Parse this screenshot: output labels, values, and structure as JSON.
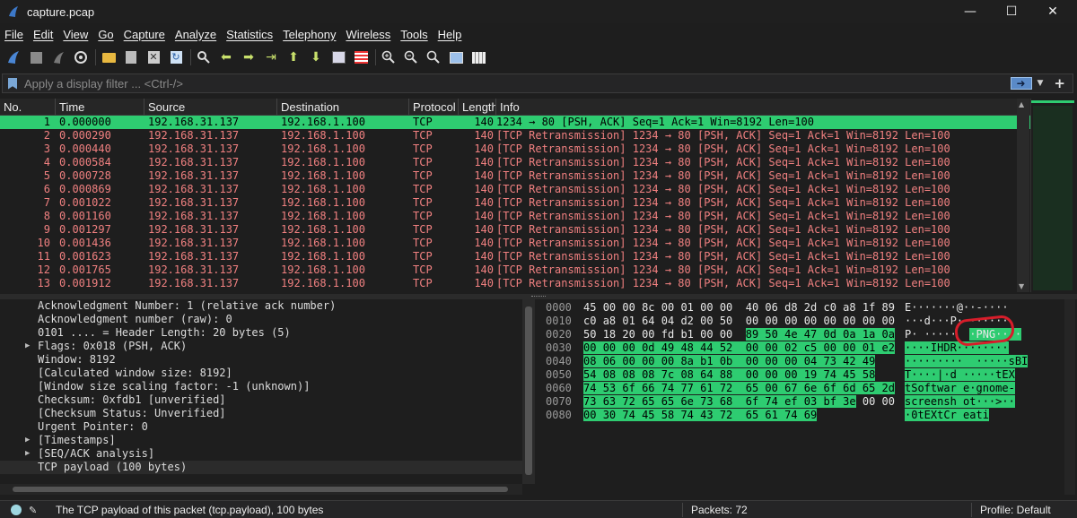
{
  "window": {
    "title": "capture.pcap"
  },
  "menu": [
    "File",
    "Edit",
    "View",
    "Go",
    "Capture",
    "Analyze",
    "Statistics",
    "Telephony",
    "Wireless",
    "Tools",
    "Help"
  ],
  "toolbar": {
    "icons": [
      "shark-fin-start-icon",
      "stop-icon",
      "restart-icon",
      "options-gear-icon",
      "open-folder-icon",
      "save-file-icon",
      "close-file-icon",
      "reload-icon",
      "find-icon",
      "go-back-icon",
      "go-forward-icon",
      "go-to-packet-icon",
      "go-first-icon",
      "go-last-icon",
      "autoscroll-icon",
      "colorize-icon",
      "zoom-in-icon",
      "zoom-out-icon",
      "zoom-normal-icon",
      "resize-columns-icon",
      "expand-icon"
    ]
  },
  "filter": {
    "placeholder": "Apply a display filter ... <Ctrl-/>"
  },
  "packet_list": {
    "columns": [
      "No.",
      "Time",
      "Source",
      "Destination",
      "Protocol",
      "Length",
      "Info"
    ],
    "rows": [
      {
        "no": "1",
        "time": "0.000000",
        "src": "192.168.31.137",
        "dst": "192.168.1.100",
        "proto": "TCP",
        "len": "140",
        "info": "1234 → 80 [PSH, ACK] Seq=1 Ack=1 Win=8192 Len=100",
        "selected": true
      },
      {
        "no": "2",
        "time": "0.000290",
        "src": "192.168.31.137",
        "dst": "192.168.1.100",
        "proto": "TCP",
        "len": "140",
        "info": "[TCP Retransmission] 1234 → 80 [PSH, ACK] Seq=1 Ack=1 Win=8192 Len=100"
      },
      {
        "no": "3",
        "time": "0.000440",
        "src": "192.168.31.137",
        "dst": "192.168.1.100",
        "proto": "TCP",
        "len": "140",
        "info": "[TCP Retransmission] 1234 → 80 [PSH, ACK] Seq=1 Ack=1 Win=8192 Len=100"
      },
      {
        "no": "4",
        "time": "0.000584",
        "src": "192.168.31.137",
        "dst": "192.168.1.100",
        "proto": "TCP",
        "len": "140",
        "info": "[TCP Retransmission] 1234 → 80 [PSH, ACK] Seq=1 Ack=1 Win=8192 Len=100"
      },
      {
        "no": "5",
        "time": "0.000728",
        "src": "192.168.31.137",
        "dst": "192.168.1.100",
        "proto": "TCP",
        "len": "140",
        "info": "[TCP Retransmission] 1234 → 80 [PSH, ACK] Seq=1 Ack=1 Win=8192 Len=100"
      },
      {
        "no": "6",
        "time": "0.000869",
        "src": "192.168.31.137",
        "dst": "192.168.1.100",
        "proto": "TCP",
        "len": "140",
        "info": "[TCP Retransmission] 1234 → 80 [PSH, ACK] Seq=1 Ack=1 Win=8192 Len=100"
      },
      {
        "no": "7",
        "time": "0.001022",
        "src": "192.168.31.137",
        "dst": "192.168.1.100",
        "proto": "TCP",
        "len": "140",
        "info": "[TCP Retransmission] 1234 → 80 [PSH, ACK] Seq=1 Ack=1 Win=8192 Len=100"
      },
      {
        "no": "8",
        "time": "0.001160",
        "src": "192.168.31.137",
        "dst": "192.168.1.100",
        "proto": "TCP",
        "len": "140",
        "info": "[TCP Retransmission] 1234 → 80 [PSH, ACK] Seq=1 Ack=1 Win=8192 Len=100"
      },
      {
        "no": "9",
        "time": "0.001297",
        "src": "192.168.31.137",
        "dst": "192.168.1.100",
        "proto": "TCP",
        "len": "140",
        "info": "[TCP Retransmission] 1234 → 80 [PSH, ACK] Seq=1 Ack=1 Win=8192 Len=100"
      },
      {
        "no": "10",
        "time": "0.001436",
        "src": "192.168.31.137",
        "dst": "192.168.1.100",
        "proto": "TCP",
        "len": "140",
        "info": "[TCP Retransmission] 1234 → 80 [PSH, ACK] Seq=1 Ack=1 Win=8192 Len=100"
      },
      {
        "no": "11",
        "time": "0.001623",
        "src": "192.168.31.137",
        "dst": "192.168.1.100",
        "proto": "TCP",
        "len": "140",
        "info": "[TCP Retransmission] 1234 → 80 [PSH, ACK] Seq=1 Ack=1 Win=8192 Len=100"
      },
      {
        "no": "12",
        "time": "0.001765",
        "src": "192.168.31.137",
        "dst": "192.168.1.100",
        "proto": "TCP",
        "len": "140",
        "info": "[TCP Retransmission] 1234 → 80 [PSH, ACK] Seq=1 Ack=1 Win=8192 Len=100"
      },
      {
        "no": "13",
        "time": "0.001912",
        "src": "192.168.31.137",
        "dst": "192.168.1.100",
        "proto": "TCP",
        "len": "140",
        "info": "[TCP Retransmission] 1234 → 80 [PSH, ACK] Seq=1 Ack=1 Win=8192 Len=100"
      }
    ]
  },
  "details": [
    {
      "text": "Acknowledgment Number: 1    (relative ack number)",
      "expander": false
    },
    {
      "text": "Acknowledgment number (raw): 0",
      "expander": false
    },
    {
      "text": "0101 .... = Header Length: 20 bytes (5)",
      "expander": false
    },
    {
      "text": "Flags: 0x018 (PSH, ACK)",
      "expander": true
    },
    {
      "text": "Window: 8192",
      "expander": false
    },
    {
      "text": "[Calculated window size: 8192]",
      "expander": false
    },
    {
      "text": "[Window size scaling factor: -1 (unknown)]",
      "expander": false
    },
    {
      "text": "Checksum: 0xfdb1 [unverified]",
      "expander": false
    },
    {
      "text": "[Checksum Status: Unverified]",
      "expander": false
    },
    {
      "text": "Urgent Pointer: 0",
      "expander": false
    },
    {
      "text": "[Timestamps]",
      "expander": true
    },
    {
      "text": "[SEQ/ACK analysis]",
      "expander": true
    },
    {
      "text": "TCP payload (100 bytes)",
      "expander": false,
      "selected": true
    }
  ],
  "hex": [
    {
      "off": "0000",
      "bytes": [
        "45",
        "00",
        "00",
        "8c",
        "00",
        "01",
        "00",
        "00",
        "40",
        "06",
        "d8",
        "2d",
        "c0",
        "a8",
        "1f",
        "89"
      ],
      "ascii": "E·······@··-····",
      "hl_from": 16
    },
    {
      "off": "0010",
      "bytes": [
        "c0",
        "a8",
        "01",
        "64",
        "04",
        "d2",
        "00",
        "50",
        "00",
        "00",
        "00",
        "00",
        "00",
        "00",
        "00",
        "00"
      ],
      "ascii": "···d···P········",
      "hl_from": 16
    },
    {
      "off": "0020",
      "bytes": [
        "50",
        "18",
        "20",
        "00",
        "fd",
        "b1",
        "00",
        "00",
        "89",
        "50",
        "4e",
        "47",
        "0d",
        "0a",
        "1a",
        "0a"
      ],
      "ascii": "P· ·····  ·PNG····",
      "hl_from": 8
    },
    {
      "off": "0030",
      "bytes": [
        "00",
        "00",
        "00",
        "0d",
        "49",
        "48",
        "44",
        "52",
        "00",
        "00",
        "02",
        "c5",
        "00",
        "00",
        "01",
        "e2"
      ],
      "ascii": "····IHDR········",
      "hl_from": 0
    },
    {
      "off": "0040",
      "bytes": [
        "08",
        "06",
        "00",
        "00",
        "00",
        "8a",
        "b1",
        "0b",
        "00",
        "00",
        "00",
        "04",
        "73",
        "42",
        "49"
      ],
      "ascii": "·········  ·····sBI",
      "hl_from": 0
    },
    {
      "off": "0050",
      "bytes": [
        "54",
        "08",
        "08",
        "08",
        "7c",
        "08",
        "64",
        "88",
        "00",
        "00",
        "00",
        "19",
        "74",
        "45",
        "58"
      ],
      "ascii": "T····|·d ·····tEX",
      "hl_from": 0
    },
    {
      "off": "0060",
      "bytes": [
        "74",
        "53",
        "6f",
        "66",
        "74",
        "77",
        "61",
        "72",
        "65",
        "00",
        "67",
        "6e",
        "6f",
        "6d",
        "65",
        "2d"
      ],
      "ascii": "tSoftwar e·gnome-",
      "hl_from": 0
    },
    {
      "off": "0070",
      "bytes": [
        "73",
        "63",
        "72",
        "65",
        "65",
        "6e",
        "73",
        "68",
        "6f",
        "74",
        "ef",
        "03",
        "bf",
        "3e",
        "00",
        "00"
      ],
      "ascii": "screensh ot···>··",
      "hl_from": 0,
      "hl_to": 14
    },
    {
      "off": "0080",
      "bytes": [
        "00",
        "30",
        "74",
        "45",
        "58",
        "74",
        "43",
        "72",
        "65",
        "61",
        "74",
        "69"
      ],
      "ascii": "·0tEXtCr eati",
      "hl_from": 0
    }
  ],
  "status": {
    "text": "The TCP payload of this packet (tcp.payload), 100 bytes",
    "packets": "Packets: 72",
    "profile": "Profile: Default"
  },
  "colors": {
    "selected_row": "#2ecc71",
    "retrans_text": "#f08080",
    "annotation_circle": "#d71d2a"
  }
}
